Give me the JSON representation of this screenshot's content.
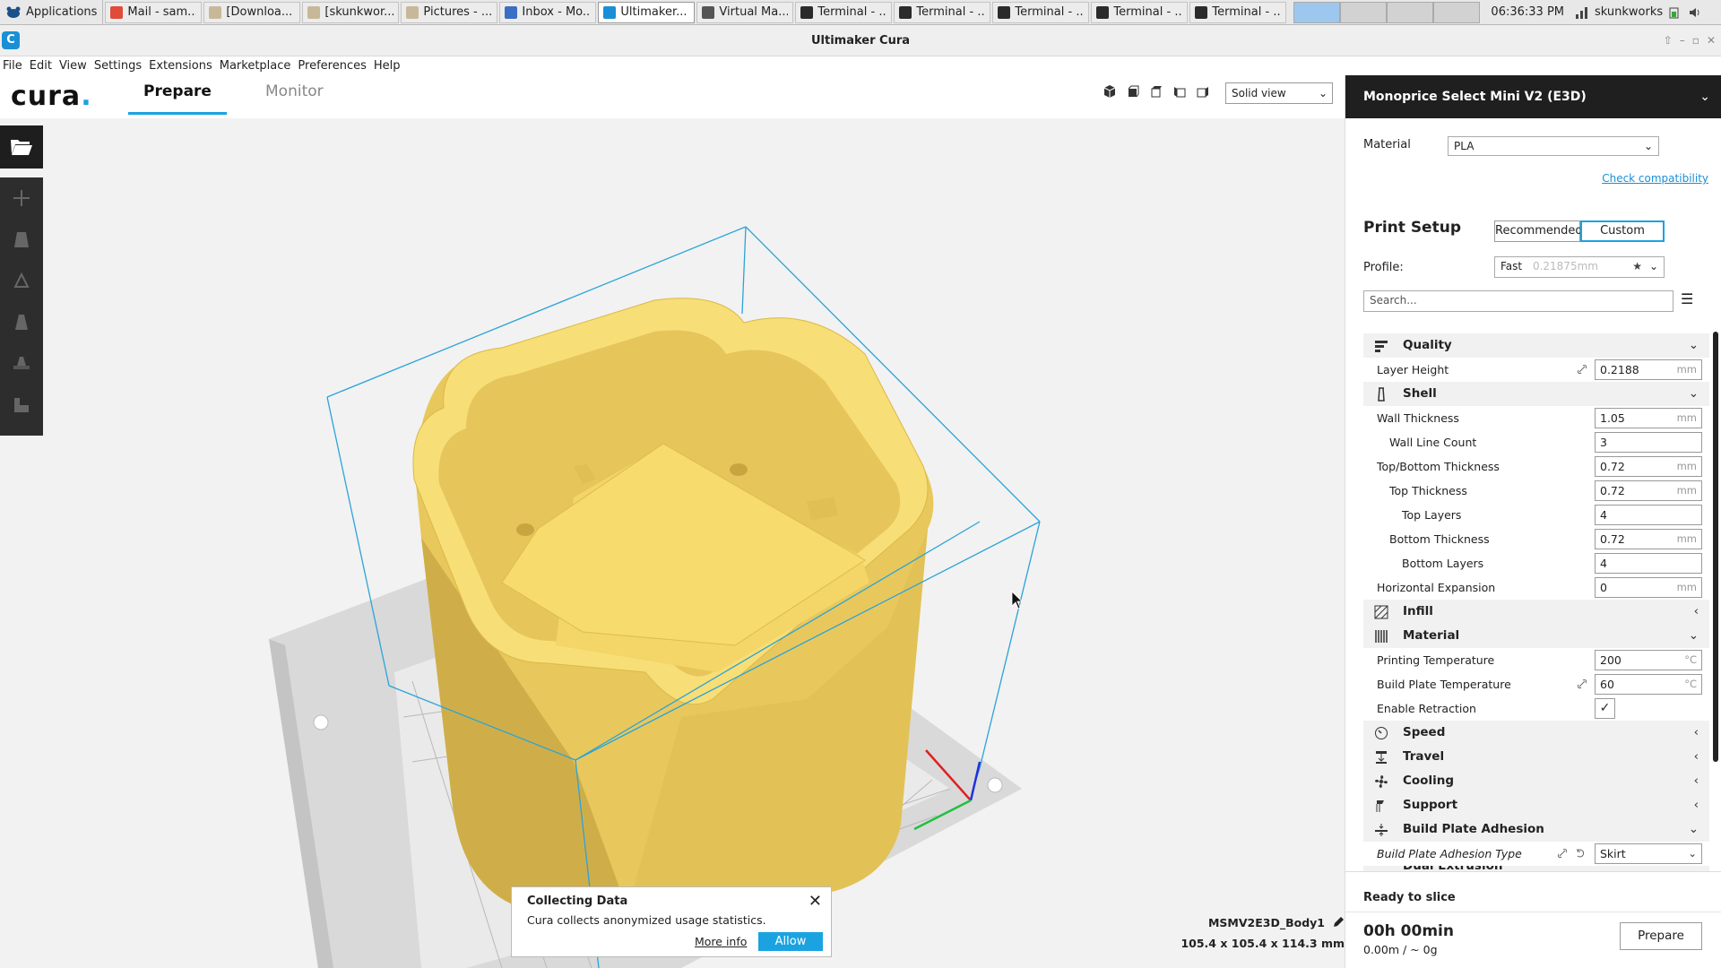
{
  "taskbar": {
    "apps_label": "Applications",
    "tasks": [
      {
        "label": "Mail - sam...",
        "color": "#e04b3a"
      },
      {
        "label": "[Downloa...",
        "color": "#c8b89a"
      },
      {
        "label": "[skunkwor...",
        "color": "#c8b89a"
      },
      {
        "label": "Pictures - ...",
        "color": "#c8b89a"
      },
      {
        "label": "Inbox - Mo...",
        "color": "#3a6fc4"
      },
      {
        "label": "Ultimaker...",
        "color": "#1a8fd6"
      },
      {
        "label": "Virtual Ma...",
        "color": "#555555"
      },
      {
        "label": "Terminal - ...",
        "color": "#2b2b2b"
      },
      {
        "label": "Terminal - ...",
        "color": "#2b2b2b"
      },
      {
        "label": "Terminal - ...",
        "color": "#2b2b2b"
      },
      {
        "label": "Terminal - ...",
        "color": "#2b2b2b"
      },
      {
        "label": "Terminal - ...",
        "color": "#2b2b2b"
      }
    ],
    "clock": "06:36:33 PM",
    "user": "skunkworks"
  },
  "window": {
    "title": "Ultimaker Cura"
  },
  "menu": [
    "File",
    "Edit",
    "View",
    "Settings",
    "Extensions",
    "Marketplace",
    "Preferences",
    "Help"
  ],
  "header": {
    "logo": "cura",
    "tabs": {
      "prepare": "Prepare",
      "monitor": "Monitor"
    },
    "view_select": "Solid view"
  },
  "printer": {
    "name": "Monoprice Select Mini V2 (E3D)",
    "material_label": "Material",
    "material_value": "PLA",
    "check_link": "Check compatibility"
  },
  "print_setup": {
    "title": "Print Setup",
    "mode_recommended": "Recommended",
    "mode_custom": "Custom",
    "profile_label": "Profile:",
    "profile_value": "Fast",
    "profile_sub": "0.21875mm",
    "search_placeholder": "Search..."
  },
  "categories": {
    "quality": "Quality",
    "shell": "Shell",
    "infill": "Infill",
    "material": "Material",
    "speed": "Speed",
    "travel": "Travel",
    "cooling": "Cooling",
    "support": "Support",
    "adhesion": "Build Plate Adhesion",
    "dual": "Dual Extrusion"
  },
  "settings": {
    "layer_height": {
      "label": "Layer Height",
      "value": "0.2188",
      "unit": "mm"
    },
    "wall_thickness": {
      "label": "Wall Thickness",
      "value": "1.05",
      "unit": "mm"
    },
    "wall_line_count": {
      "label": "Wall Line Count",
      "value": "3"
    },
    "top_bottom_thickness": {
      "label": "Top/Bottom Thickness",
      "value": "0.72",
      "unit": "mm"
    },
    "top_thickness": {
      "label": "Top Thickness",
      "value": "0.72",
      "unit": "mm"
    },
    "top_layers": {
      "label": "Top Layers",
      "value": "4"
    },
    "bottom_thickness": {
      "label": "Bottom Thickness",
      "value": "0.72",
      "unit": "mm"
    },
    "bottom_layers": {
      "label": "Bottom Layers",
      "value": "4"
    },
    "horizontal_expansion": {
      "label": "Horizontal Expansion",
      "value": "0",
      "unit": "mm"
    },
    "printing_temperature": {
      "label": "Printing Temperature",
      "value": "200",
      "unit": "°C"
    },
    "build_plate_temperature": {
      "label": "Build Plate Temperature",
      "value": "60",
      "unit": "°C"
    },
    "enable_retraction": {
      "label": "Enable Retraction",
      "checked": true
    },
    "adhesion_type": {
      "label": "Build Plate Adhesion Type",
      "value": "Skirt"
    }
  },
  "slice": {
    "status": "Ready to slice",
    "time": "00h 00min",
    "estimate": "0.00m / ~ 0g",
    "button": "Prepare"
  },
  "notification": {
    "title": "Collecting Data",
    "message": "Cura collects anonymized usage statistics.",
    "more_info": "More info",
    "allow": "Allow"
  },
  "object": {
    "name": "MSMV2E3D_Body1",
    "dimensions": "105.4 x 105.4 x 114.3 mm"
  },
  "colors": {
    "accent": "#1aa3e0",
    "model": "#f5d76e",
    "dark_panel": "#1f1f1f"
  }
}
